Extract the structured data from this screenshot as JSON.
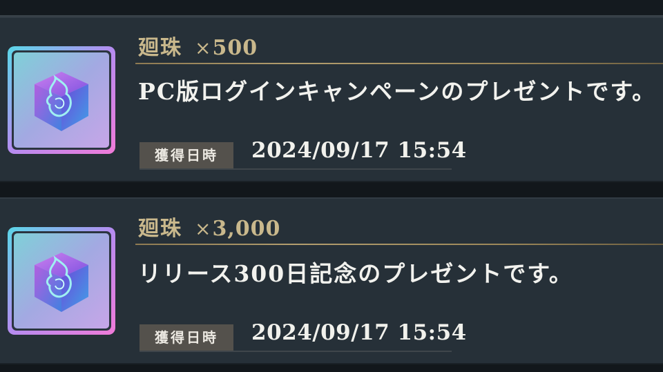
{
  "gifts": [
    {
      "item_name": "廻珠",
      "quantity_prefix": "×",
      "quantity": "500",
      "message": "PC版ログインキャンペーンのプレゼントです。",
      "date_label": "獲得日時",
      "date_value": "2024/09/17 15:54",
      "icon": "crystal-cube-icon"
    },
    {
      "item_name": "廻珠",
      "quantity_prefix": "×",
      "quantity": "3,000",
      "message": "リリース300日記念のプレゼントです。",
      "date_label": "獲得日時",
      "date_value": "2024/09/17 15:54",
      "icon": "crystal-cube-icon"
    }
  ],
  "colors": {
    "card_bg": "#263038",
    "gap_bg": "#12171b",
    "title_gold": "#c9b88c",
    "message_text": "#f2f2ee",
    "label_bg": "#54514c"
  }
}
